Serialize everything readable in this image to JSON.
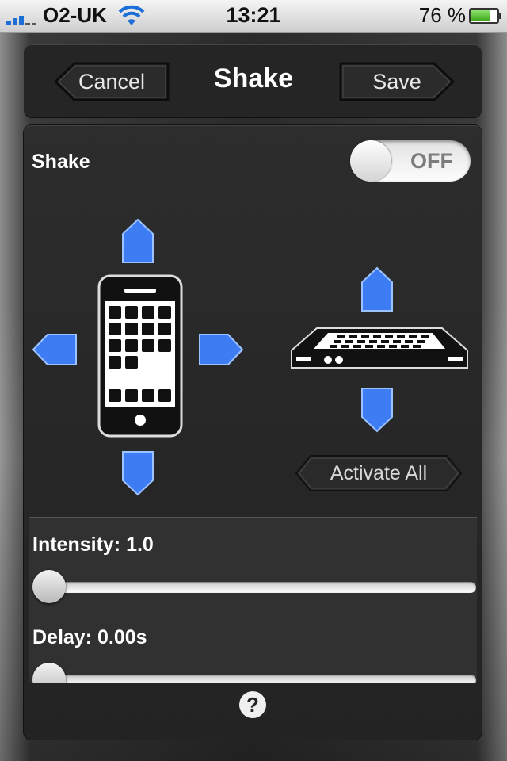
{
  "status_bar": {
    "carrier": "O2-UK",
    "time": "13:21",
    "battery_percent": "76 %",
    "battery_level": 0.76,
    "signal_icon": "signal-bars-icon",
    "wifi_icon": "wifi-icon"
  },
  "nav": {
    "cancel_label": "Cancel",
    "title": "Shake",
    "save_label": "Save"
  },
  "shake": {
    "label": "Shake",
    "toggle_state": "OFF"
  },
  "directions": {
    "phone_icon": "phone-upright-icon",
    "flat_icon": "phone-flat-icon",
    "arrow_color": "#3d7cf2"
  },
  "activate_all_label": "Activate All",
  "intensity": {
    "label": "Intensity: 1.0",
    "value": 1.0
  },
  "delay": {
    "label": "Delay: 0.00s",
    "value": 0.0
  },
  "help": {
    "label": "?",
    "icon": "help-icon"
  }
}
